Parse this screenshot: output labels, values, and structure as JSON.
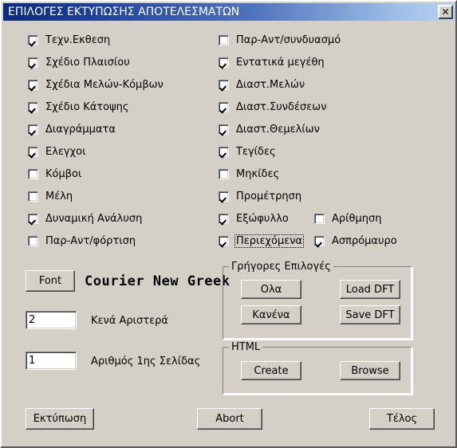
{
  "window": {
    "title": "ΕΠΙΛΟΓΕΣ ΕΚΤΥΠΩΣΗΣ ΑΠΟΤΕΛΕΣΜΑΤΩΝ",
    "close_label": "✕",
    "titlebar_color_left": "#0a2a7a",
    "titlebar_color_right": "#b6d2f0",
    "face_color": "#d4d0c8"
  },
  "checkboxes": {
    "left_column": [
      {
        "label": "Τεχν.Εκθεση",
        "checked": true
      },
      {
        "label": "Σχέδιο Πλαισίου",
        "checked": true
      },
      {
        "label": "Σχέδια Μελών-Κόμβων",
        "checked": true
      },
      {
        "label": "Σχέδιο Κάτοψης",
        "checked": true
      },
      {
        "label": "Διαγράμματα",
        "checked": true
      },
      {
        "label": "Ελεγχοι",
        "checked": true
      },
      {
        "label": "Κόμβοι",
        "checked": false
      },
      {
        "label": "Μέλη",
        "checked": false
      },
      {
        "label": "Δυναμική Ανάλυση",
        "checked": true
      },
      {
        "label": "Παρ-Αντ/φόρτιση",
        "checked": false
      }
    ],
    "right_column": [
      {
        "label": "Παρ-Αντ/συνδυασμό",
        "checked": false
      },
      {
        "label": "Εντατικά μεγέθη",
        "checked": true
      },
      {
        "label": "Διαστ.Μελών",
        "checked": true
      },
      {
        "label": "Διαστ.Συνδέσεων",
        "checked": true
      },
      {
        "label": "Διαστ.Θεμελίων",
        "checked": true
      },
      {
        "label": "Τεγίδες",
        "checked": true
      },
      {
        "label": "Μηκίδες",
        "checked": false
      },
      {
        "label": "Προμέτρηση",
        "checked": true
      },
      {
        "label": "Εξώφυλλο",
        "checked": true
      },
      {
        "label": "Περιεχόμενα",
        "checked": true,
        "focused": true
      }
    ],
    "far_column": [
      {
        "label": "Αρίθμηση",
        "checked": false
      },
      {
        "label": "Ασπρόμαυρο",
        "checked": true
      }
    ]
  },
  "font_section": {
    "button_label": "Font",
    "font_name": "Courier New Greek"
  },
  "fields": [
    {
      "value": "2",
      "label": "Κενά Αριστερά"
    },
    {
      "value": "1",
      "label": "Αριθμός 1ης Σελίδας"
    }
  ],
  "quick_options_group": {
    "title": "Γρήγορες Επιλογές",
    "buttons": [
      {
        "label": "Ολα"
      },
      {
        "label": "Load DFT"
      },
      {
        "label": "Κανένα"
      },
      {
        "label": "Save DFT"
      }
    ]
  },
  "html_group": {
    "title": "HTML",
    "buttons": [
      {
        "label": "Create"
      },
      {
        "label": "Browse"
      }
    ]
  },
  "bottom_buttons": [
    {
      "label": "Εκτύπωση"
    },
    {
      "label": "Abort"
    },
    {
      "label": "Τέλος"
    }
  ]
}
